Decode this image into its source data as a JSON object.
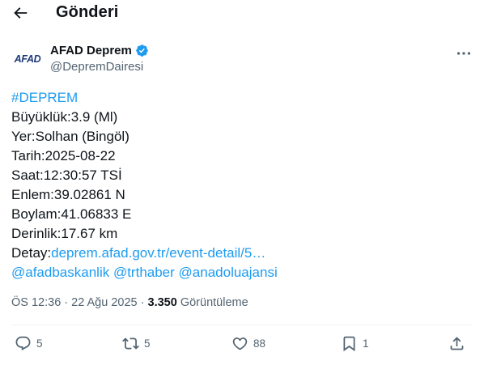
{
  "header": {
    "title": "Gönderi"
  },
  "author": {
    "avatar_text": "AFAD",
    "display_name": "AFAD Deprem",
    "handle": "@DepremDairesi"
  },
  "tweet": {
    "hashtag": "#DEPREM",
    "lines": [
      "Büyüklük:3.9 (Ml)",
      "Yer:Solhan (Bingöl)",
      "Tarih:2025-08-22",
      "Saat:12:30:57 TSİ",
      "Enlem:39.02861 N",
      "Boylam:41.06833 E",
      "Derinlik:17.67 km"
    ],
    "detail_prefix": "Detay:",
    "detail_link": "deprem.afad.gov.tr/event-detail/5…",
    "mentions": [
      "@afadbaskanlik",
      "@trthaber",
      "@anadoluajansi"
    ]
  },
  "meta": {
    "time": "ÖS 12:36",
    "date": "22 Ağu 2025",
    "views_count": "3.350",
    "views_label": "Görüntüleme"
  },
  "actions": {
    "replies": "5",
    "retweets": "5",
    "likes": "88",
    "bookmarks": "1"
  },
  "colors": {
    "link": "#1d9bf0",
    "muted": "#536471",
    "text": "#0f1419",
    "verified": "#1d9bf0",
    "afad_blue": "#1e3a78",
    "afad_red": "#e30a17"
  },
  "icons": {
    "back": "arrow-left-icon",
    "verified": "verified-badge-icon",
    "more": "more-horizontal-icon",
    "reply": "reply-icon",
    "retweet": "retweet-icon",
    "like": "heart-icon",
    "bookmark": "bookmark-icon",
    "share": "share-icon"
  }
}
